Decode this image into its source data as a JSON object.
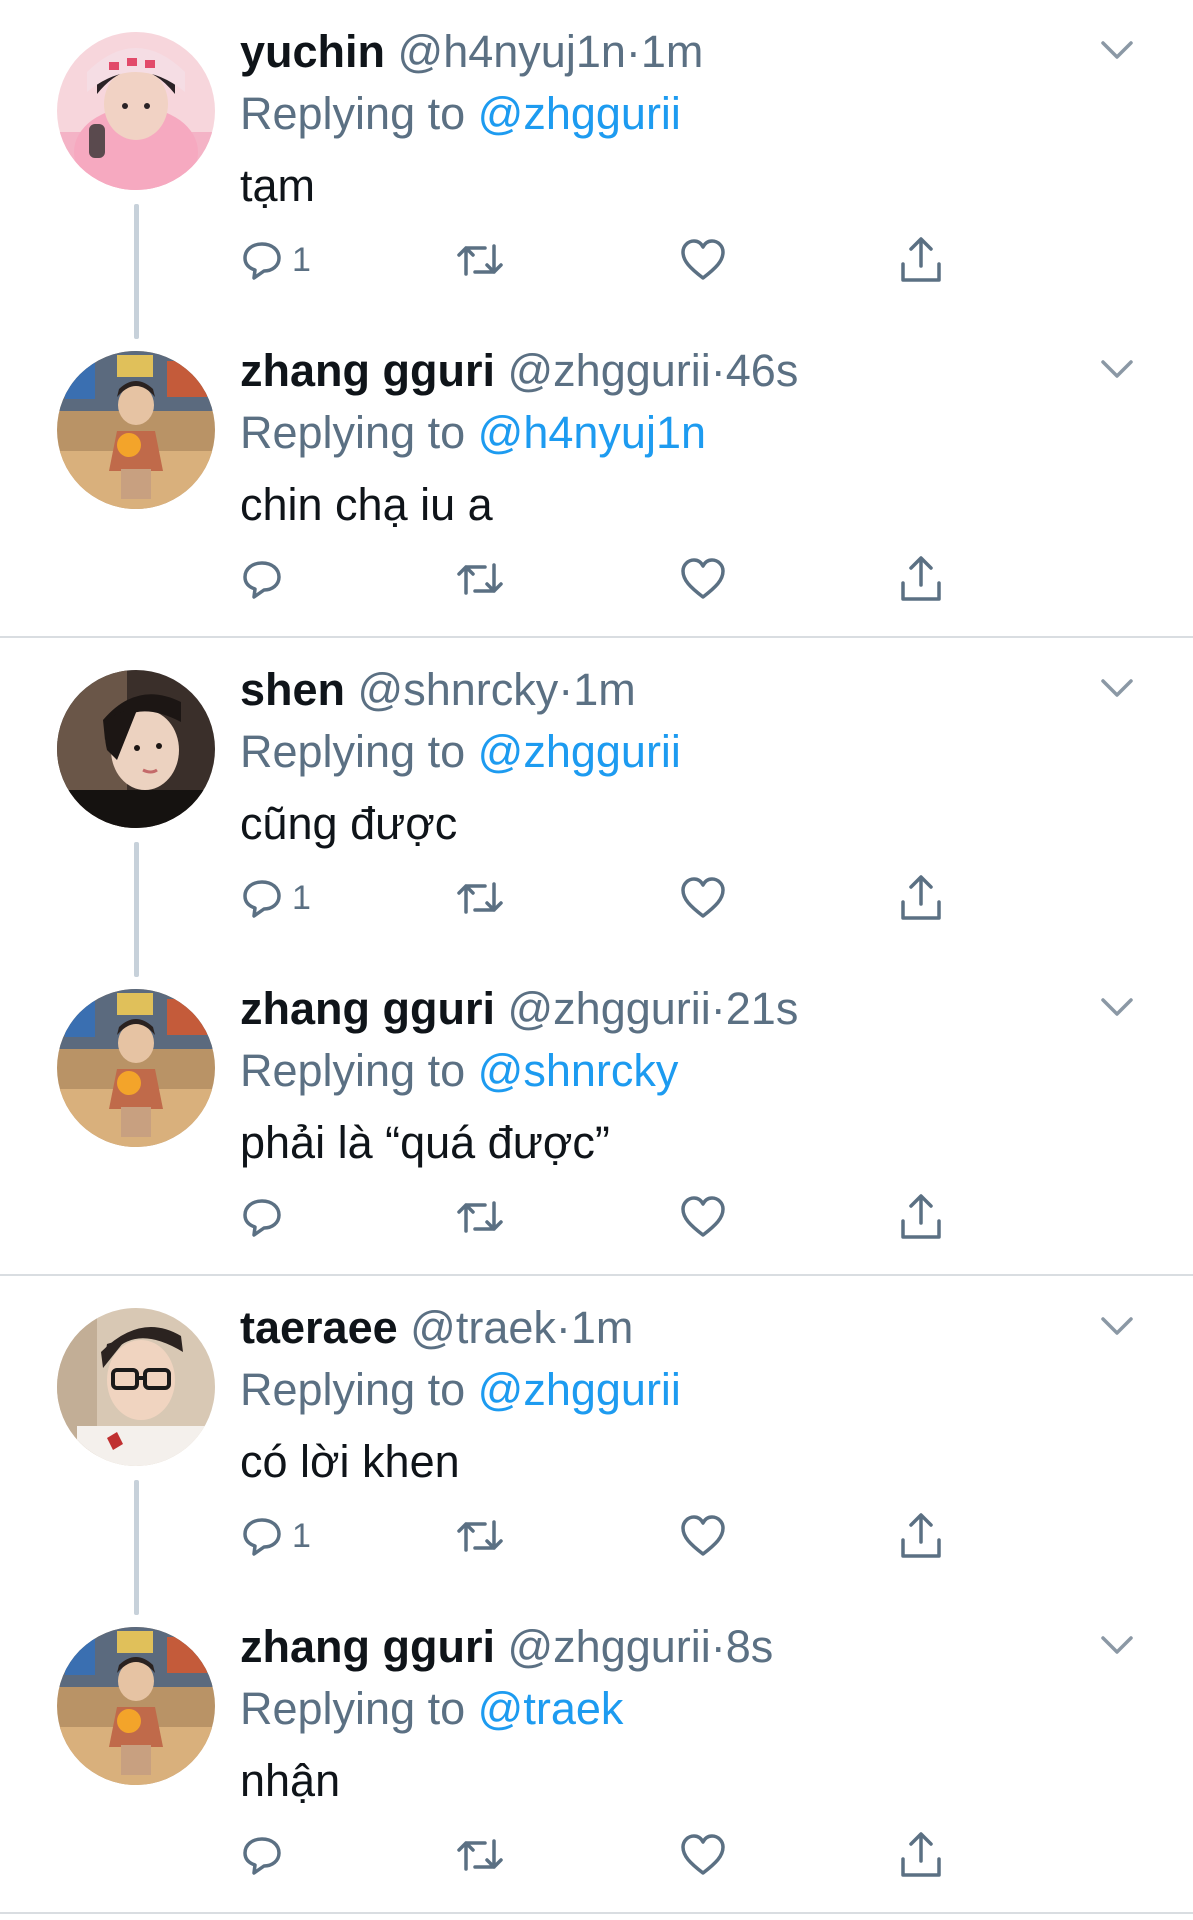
{
  "groups": [
    {
      "tweets": [
        {
          "display_name": "yuchin",
          "handle": "@h4nyuj1n",
          "separator": "·",
          "time": "1m",
          "replying_prefix": "Replying to",
          "replying_to": "@zhggurii",
          "text": "tạm",
          "reply_count": "1",
          "avatar": "pink-hoodie-person"
        },
        {
          "display_name": "zhang gguri",
          "handle": "@zhggurii",
          "separator": "·",
          "time": "46s",
          "replying_prefix": "Replying to",
          "replying_to": "@h4nyuj1n",
          "text": "chin chạ iu a",
          "reply_count": "",
          "avatar": "room-person-with-drink"
        }
      ]
    },
    {
      "tweets": [
        {
          "display_name": "shen",
          "handle": "@shnrcky",
          "separator": "·",
          "time": "1m",
          "replying_prefix": "Replying to",
          "replying_to": "@zhggurii",
          "text": "cũng được",
          "reply_count": "1",
          "avatar": "dark-hair-person"
        },
        {
          "display_name": "zhang gguri",
          "handle": "@zhggurii",
          "separator": "·",
          "time": "21s",
          "replying_prefix": "Replying to",
          "replying_to": "@shnrcky",
          "text": "phải là “quá được”",
          "reply_count": "",
          "avatar": "room-person-with-drink"
        }
      ]
    },
    {
      "tweets": [
        {
          "display_name": "taeraee",
          "handle": "@traek",
          "separator": "·",
          "time": "1m",
          "replying_prefix": "Replying to",
          "replying_to": "@zhggurii",
          "text": "có lời khen",
          "reply_count": "1",
          "avatar": "glasses-person"
        },
        {
          "display_name": "zhang gguri",
          "handle": "@zhggurii",
          "separator": "·",
          "time": "8s",
          "replying_prefix": "Replying to",
          "replying_to": "@traek",
          "text": "nhận",
          "reply_count": "",
          "avatar": "room-person-with-drink"
        }
      ]
    }
  ],
  "icons": {
    "reply": "reply-icon",
    "retweet": "retweet-icon",
    "like": "heart-icon",
    "share": "share-icon",
    "more": "chevron-down-icon"
  },
  "colors": {
    "link": "#1d9bf0",
    "secondary_text": "#5b7083",
    "primary_text": "#0f1419",
    "divider": "#d9dde1",
    "thread_line": "#c7d1da"
  }
}
